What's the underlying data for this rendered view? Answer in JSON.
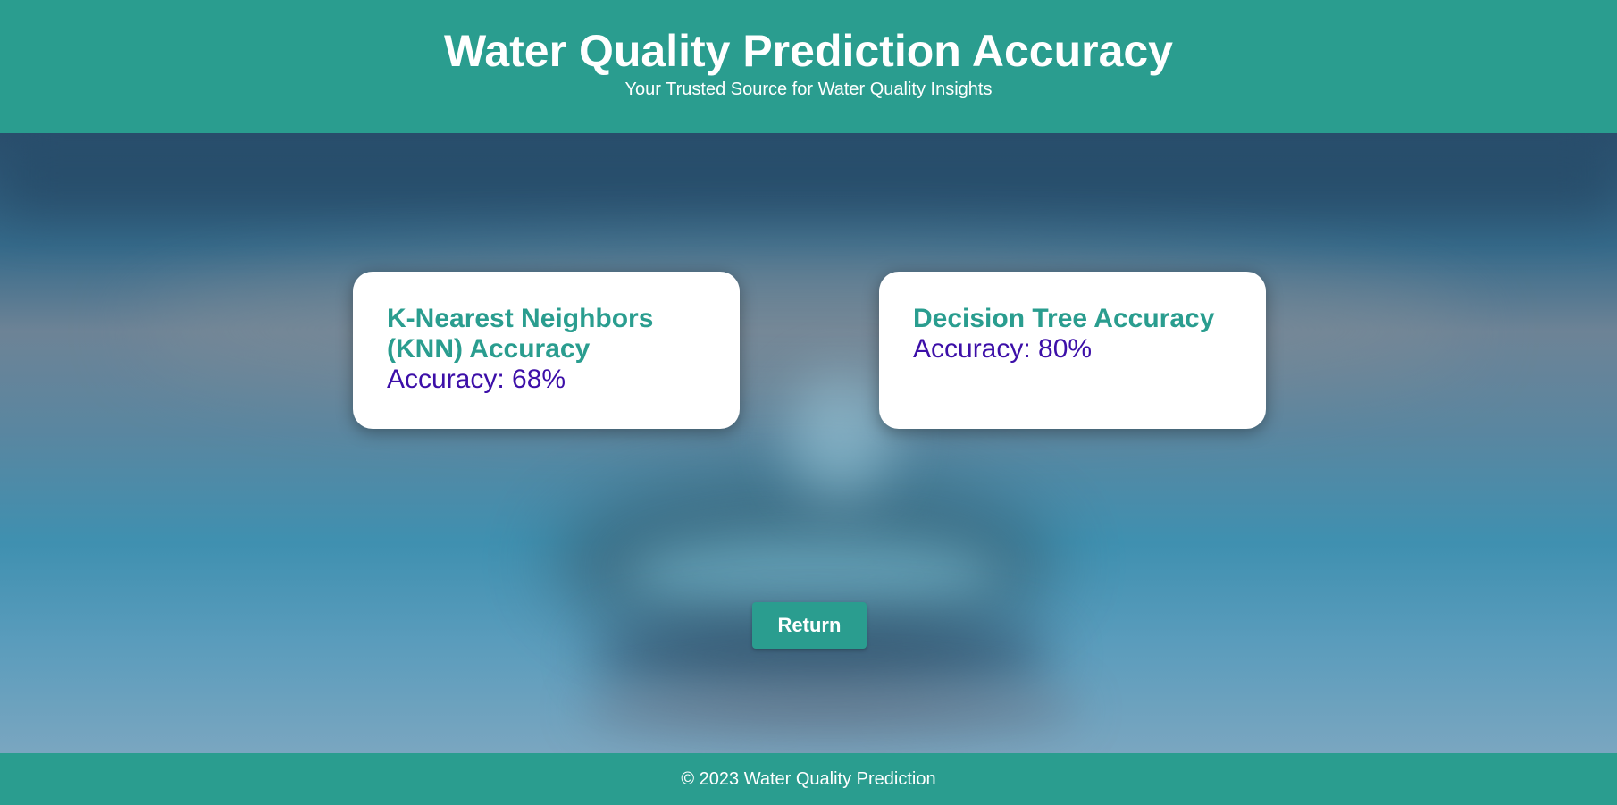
{
  "header": {
    "title": "Water Quality Prediction Accuracy",
    "subtitle": "Your Trusted Source for Water Quality Insights"
  },
  "cards": [
    {
      "title": "K-Nearest Neighbors (KNN) Accuracy",
      "accuracy_text": "Accuracy: 68%"
    },
    {
      "title": "Decision Tree Accuracy",
      "accuracy_text": "Accuracy: 80%"
    }
  ],
  "actions": {
    "return_label": "Return"
  },
  "footer": {
    "text": "© 2023 Water Quality Prediction"
  },
  "colors": {
    "primary": "#2a9d8f",
    "accuracy_text": "#3c0fa8",
    "card_background": "#ffffff"
  }
}
